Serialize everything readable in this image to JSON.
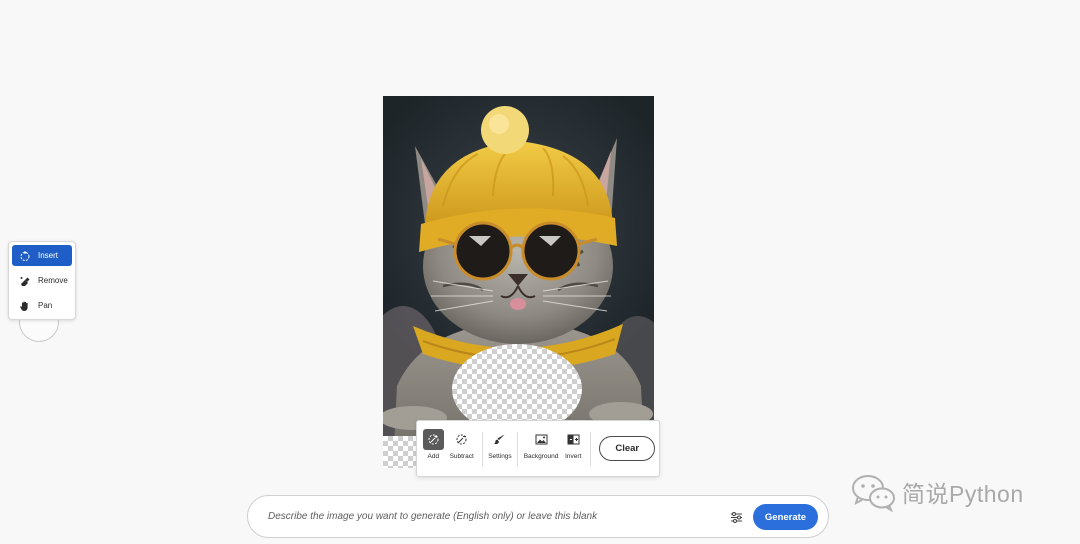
{
  "tool_menu": {
    "items": [
      {
        "label": "Insert",
        "icon": "insert-brush-icon",
        "active": true
      },
      {
        "label": "Remove",
        "icon": "eraser-icon",
        "active": false
      },
      {
        "label": "Pan",
        "icon": "hand-icon",
        "active": false
      }
    ]
  },
  "mask_toolbar": {
    "add_label": "Add",
    "subtract_label": "Subtract",
    "settings_label": "Settings",
    "background_label": "Background",
    "invert_label": "Invert",
    "clear_label": "Clear"
  },
  "prompt": {
    "placeholder": "Describe the image you want to generate (English only) or leave this blank",
    "generate_label": "Generate"
  },
  "watermark": {
    "text": "简说Python",
    "icon": "wechat-icon"
  },
  "colors": {
    "accent": "#2a6fdb",
    "active_tool": "#1f5ec6",
    "hat_yellow": "#e9b92f"
  }
}
